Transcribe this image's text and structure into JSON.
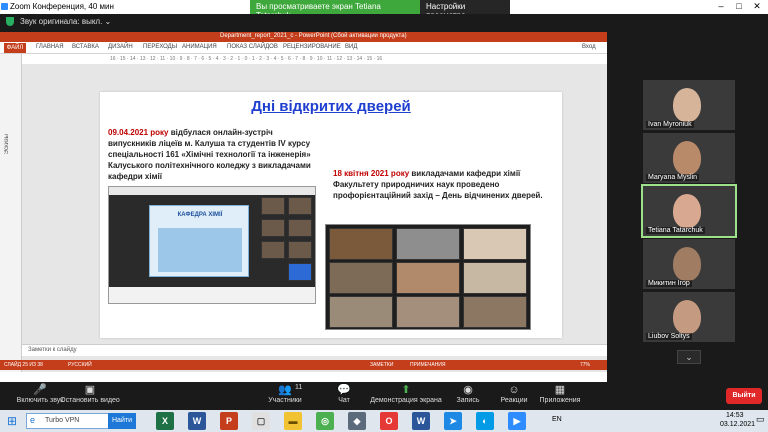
{
  "zoom": {
    "window_title": "Zoom Конференция, 40 мин",
    "share_banner": "Вы просматриваете экран Tetiana Tatarchuk",
    "view_options": "Настройки просмотра",
    "original_sound": "Звук оригинала: выкл."
  },
  "powerpoint": {
    "doc_title": "Department_report_2021_c - PowerPoint (Сбой активации продукта)",
    "tabs": [
      "ФАЙЛ",
      "ГЛАВНАЯ",
      "ВСТАВКА",
      "ДИЗАЙН",
      "ПЕРЕХОДЫ",
      "АНИМАЦИЯ",
      "ПОКАЗ СЛАЙДОВ",
      "РЕЦЕНЗИРОВАНИЕ",
      "ВИД"
    ],
    "view_label": "Вход",
    "ruler": "16 · 15 · 14 · 13 · 12 · 11 · 10 · 9 · 8 · 7 · 6 · 5 · 4 · 3 · 2 · 1 · 0 · 1 · 2 · 3 · 4 · 5 · 6 · 7 · 8 · 9 · 10 · 11 · 12 · 13 · 14 · 15 · 16",
    "thumb_label": "Эскизы",
    "notes_placeholder": "Заметки к слайду",
    "status_left": "СЛАЙД 25 ИЗ 38",
    "status_lang": "РУССКИЙ",
    "status_notes": "ЗАМЕТКИ",
    "status_comments": "ПРИМЕЧАНИЯ",
    "zoom_level": "77%"
  },
  "slide": {
    "title": "Дні відкритих дверей",
    "p1_date": "09.04.2021 року",
    "p1_text": " відбулася онлайн-зустріч випускників ліцеїв м. Калуша та студентів IV курсу спеціальності 161 «Хімічні технології та інженерія» Калуського політехнічного коледжу з викладачами кафедри хімії",
    "p2_date": "18 квітня 2021 року",
    "p2_text": " викладачами кафедри хімії Факультету природничих наук проведено профорієнтаційний захід – День відчинених дверей.",
    "poster_text": "КАФЕДРА ХІМІЇ"
  },
  "participants": [
    {
      "name": "Ivan Myroniuk"
    },
    {
      "name": "Maryana Myslin"
    },
    {
      "name": "Tetiana Tatarchuk"
    },
    {
      "name": "Микитин Ігор"
    },
    {
      "name": "Liubov Soltys"
    }
  ],
  "controls": {
    "mute": "Включить звук",
    "video": "Остановить видео",
    "participants": "Участники",
    "participants_count": "11",
    "chat": "Чат",
    "share": "Демонстрация экрана",
    "record": "Запись",
    "reactions": "Реакции",
    "apps": "Приложения",
    "leave": "Выйти"
  },
  "taskbar": {
    "search_value": "Turbo VPN",
    "search_button": "Найти",
    "lang": "EN",
    "time": "14:53",
    "date": "03.12.2021"
  }
}
